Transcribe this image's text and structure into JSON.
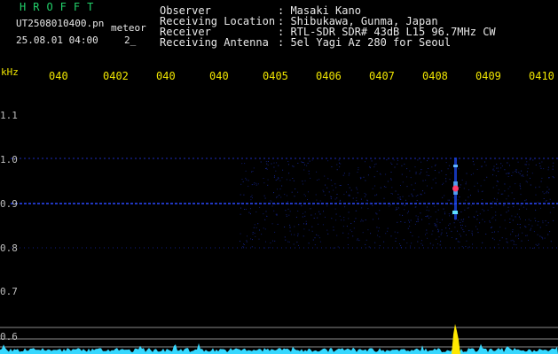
{
  "header": {
    "brand": "HROFFT",
    "file_name": "UT2508010400.pn",
    "data_type": "meteor",
    "date_time": "25.08.01 04:00",
    "count": "2_"
  },
  "info": [
    {
      "label": "Observer",
      "value": ": Masaki Kano"
    },
    {
      "label": "Receiving Location",
      "value": ": Shibukawa, Gunma, Japan"
    },
    {
      "label": "Receiver",
      "value": ": RTL-SDR SDR# 43dB L15 96.7MHz CW"
    },
    {
      "label": "Receiving Antenna",
      "value": ": 5el Yagi Az 280 for Seoul"
    }
  ],
  "axis": {
    "y_unit": "kHz",
    "y_labels": [
      "1.1",
      "1.0",
      "0.9",
      "0.8",
      "0.7",
      "0.6"
    ],
    "x_ticks": [
      "040",
      "0402",
      "040",
      "040",
      "0405",
      "0406",
      "0407",
      "0408",
      "0409",
      "0410"
    ]
  },
  "colors": {
    "background": "#000000",
    "header_green": "#22d16a",
    "tick_yellow": "#f0e600",
    "line_blue": "#2a49ff",
    "noise_cyan": "#36d8ff",
    "echo_yellow": "#ffe800"
  }
}
